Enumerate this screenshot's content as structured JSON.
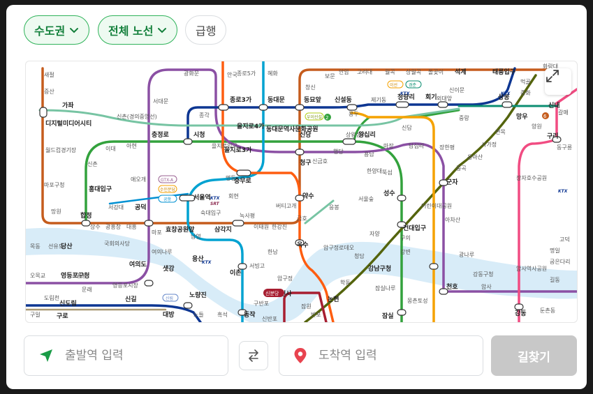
{
  "filters": {
    "region_label": "수도권",
    "lines_label": "전체 노선",
    "express_label": "급행"
  },
  "search": {
    "origin_placeholder": "출발역 입력",
    "destination_placeholder": "도착역 입력",
    "submit_label": "길찾기"
  },
  "colors": {
    "accent": "#2fb35a",
    "line1": "#0d3692",
    "line2": "#33a23d",
    "line3": "#fe5d10",
    "line4": "#00a2d1",
    "line5": "#8b50a4",
    "line6": "#c55c1d",
    "line7": "#54640d",
    "line8": "#f14c82",
    "line9": "#aa9872",
    "shinbundang": "#a71e31",
    "suinbundang": "#f5a200",
    "gyeongui": "#77c4a3",
    "river": "#d8ecf8"
  },
  "map": {
    "labels": [
      {
        "key": "s1",
        "text": "시청"
      },
      {
        "key": "s2",
        "text": "서울역"
      },
      {
        "key": "s3",
        "text": "종로3가"
      },
      {
        "key": "s4",
        "text": "동대문"
      },
      {
        "key": "s5",
        "text": "동묘앞"
      },
      {
        "key": "s6",
        "text": "신설동"
      },
      {
        "key": "s7",
        "text": "청량리"
      },
      {
        "key": "s8",
        "text": "회기"
      },
      {
        "key": "s9",
        "text": "상봉"
      },
      {
        "key": "s10",
        "text": "태릉입구"
      },
      {
        "key": "s11",
        "text": "신내"
      },
      {
        "key": "s12",
        "text": "구리"
      },
      {
        "key": "s13",
        "text": "왕십리"
      },
      {
        "key": "s14",
        "text": "신당"
      },
      {
        "key": "s15",
        "text": "동대문역사문화공원"
      },
      {
        "key": "s16",
        "text": "을지로3가"
      },
      {
        "key": "s17",
        "text": "을지로4가"
      },
      {
        "key": "s18",
        "text": "충무로"
      },
      {
        "key": "s19",
        "text": "약수"
      },
      {
        "key": "s20",
        "text": "청구"
      },
      {
        "key": "s21",
        "text": "충정로"
      },
      {
        "key": "s22",
        "text": "공덕"
      },
      {
        "key": "s23",
        "text": "합정"
      },
      {
        "key": "s24",
        "text": "홍대입구"
      },
      {
        "key": "s25",
        "text": "디지털미디어시티"
      },
      {
        "key": "s26",
        "text": "가좌"
      },
      {
        "key": "s27",
        "text": "삼각지"
      },
      {
        "key": "s28",
        "text": "효창공원앞"
      },
      {
        "key": "s29",
        "text": "용산"
      },
      {
        "key": "s30",
        "text": "이촌"
      },
      {
        "key": "s31",
        "text": "옥수"
      },
      {
        "key": "s32",
        "text": "성수"
      },
      {
        "key": "s33",
        "text": "건대입구"
      },
      {
        "key": "s34",
        "text": "군자"
      },
      {
        "key": "s35",
        "text": "천호"
      },
      {
        "key": "s36",
        "text": "강동"
      },
      {
        "key": "s37",
        "text": "잠실"
      },
      {
        "key": "s38",
        "text": "강남구청"
      },
      {
        "key": "s39",
        "text": "신사"
      },
      {
        "key": "s40",
        "text": "노량진"
      },
      {
        "key": "s41",
        "text": "여의도"
      },
      {
        "key": "s42",
        "text": "영등포구청"
      },
      {
        "key": "s43",
        "text": "당산"
      },
      {
        "key": "s44",
        "text": "신도림"
      },
      {
        "key": "s45",
        "text": "구로"
      },
      {
        "key": "s46",
        "text": "대방"
      },
      {
        "key": "s47",
        "text": "샛강"
      },
      {
        "key": "s48",
        "text": "신길"
      },
      {
        "key": "s49",
        "text": "동작"
      },
      {
        "key": "s50",
        "text": "논현"
      },
      {
        "key": "s51",
        "text": "석계"
      },
      {
        "key": "s52",
        "text": "망우"
      },
      {
        "key": "s53",
        "text": "종로5가"
      },
      {
        "key": "s54",
        "text": "혜화"
      },
      {
        "key": "s55",
        "text": "안국"
      },
      {
        "key": "s56",
        "text": "경복궁"
      },
      {
        "key": "s57",
        "text": "광화문"
      },
      {
        "key": "s58",
        "text": "서대문"
      },
      {
        "key": "s59",
        "text": "아현"
      },
      {
        "key": "s60",
        "text": "이대"
      },
      {
        "key": "s61",
        "text": "신촌"
      },
      {
        "key": "s62",
        "text": "마포구청"
      },
      {
        "key": "s63",
        "text": "망원"
      },
      {
        "key": "s64",
        "text": "상수"
      },
      {
        "key": "s65",
        "text": "광흥창"
      },
      {
        "key": "s66",
        "text": "대흥"
      },
      {
        "key": "s67",
        "text": "마포"
      },
      {
        "key": "s68",
        "text": "애오개"
      },
      {
        "key": "s69",
        "text": "서강대"
      },
      {
        "key": "s70",
        "text": "숙대입구"
      },
      {
        "key": "s71",
        "text": "남영"
      },
      {
        "key": "s72",
        "text": "녹사평"
      },
      {
        "key": "s73",
        "text": "이태원"
      },
      {
        "key": "s74",
        "text": "한강진"
      },
      {
        "key": "s75",
        "text": "버티고개"
      },
      {
        "key": "s76",
        "text": "금호"
      },
      {
        "key": "s77",
        "text": "응봉"
      },
      {
        "key": "s78",
        "text": "서빙고"
      },
      {
        "key": "s79",
        "text": "한남"
      },
      {
        "key": "s80",
        "text": "압구정"
      },
      {
        "key": "s81",
        "text": "신금호"
      },
      {
        "key": "s82",
        "text": "행당"
      },
      {
        "key": "s83",
        "text": "마장"
      },
      {
        "key": "s84",
        "text": "답십리"
      },
      {
        "key": "s85",
        "text": "장한평"
      },
      {
        "key": "s86",
        "text": "용답"
      },
      {
        "key": "s87",
        "text": "신답"
      },
      {
        "key": "s88",
        "text": "한양대"
      },
      {
        "key": "s89",
        "text": "뚝섬"
      },
      {
        "key": "s90",
        "text": "서울숲"
      },
      {
        "key": "s91",
        "text": "압구정로데오"
      },
      {
        "key": "s92",
        "text": "구의"
      },
      {
        "key": "s93",
        "text": "강변"
      },
      {
        "key": "s94",
        "text": "아차산"
      },
      {
        "key": "s95",
        "text": "광나루"
      },
      {
        "key": "s96",
        "text": "어린이대공원"
      },
      {
        "key": "s97",
        "text": "중곡"
      },
      {
        "key": "s98",
        "text": "용마산"
      },
      {
        "key": "s99",
        "text": "사가정"
      },
      {
        "key": "s100",
        "text": "면목"
      },
      {
        "key": "s101",
        "text": "중랑"
      },
      {
        "key": "s102",
        "text": "외대앞"
      },
      {
        "key": "s103",
        "text": "신이문"
      },
      {
        "key": "s104",
        "text": "고려대"
      },
      {
        "key": "s105",
        "text": "월곡"
      },
      {
        "key": "s106",
        "text": "상월곡"
      },
      {
        "key": "s107",
        "text": "돌곶이"
      },
      {
        "key": "s108",
        "text": "먹골"
      },
      {
        "key": "s109",
        "text": "중화"
      },
      {
        "key": "s110",
        "text": "화랑대"
      },
      {
        "key": "s111",
        "text": "양원"
      },
      {
        "key": "s112",
        "text": "갈매"
      },
      {
        "key": "s113",
        "text": "동구릉"
      },
      {
        "key": "s114",
        "text": "장자호수공원"
      },
      {
        "key": "s115",
        "text": "암사역사공원"
      },
      {
        "key": "s116",
        "text": "암사"
      },
      {
        "key": "s117",
        "text": "굽은다리"
      },
      {
        "key": "s118",
        "text": "명일"
      },
      {
        "key": "s119",
        "text": "고덕"
      },
      {
        "key": "s120",
        "text": "길동"
      },
      {
        "key": "s121",
        "text": "둔촌동"
      },
      {
        "key": "s122",
        "text": "강동구청"
      },
      {
        "key": "s123",
        "text": "몽촌토성"
      },
      {
        "key": "s124",
        "text": "잠실나루"
      },
      {
        "key": "s125",
        "text": "자양"
      },
      {
        "key": "s126",
        "text": "청담"
      },
      {
        "key": "s127",
        "text": "학동"
      },
      {
        "key": "s128",
        "text": "구반포"
      },
      {
        "key": "s129",
        "text": "신반포"
      },
      {
        "key": "s130",
        "text": "반포"
      },
      {
        "key": "s131",
        "text": "잠원"
      },
      {
        "key": "s132",
        "text": "흑석"
      },
      {
        "key": "s133",
        "text": "노들"
      },
      {
        "key": "s134",
        "text": "영등포시장"
      },
      {
        "key": "s135",
        "text": "양평"
      },
      {
        "key": "s136",
        "text": "문래"
      },
      {
        "key": "s137",
        "text": "도림천"
      },
      {
        "key": "s138",
        "text": "구일"
      },
      {
        "key": "s139",
        "text": "오목교"
      },
      {
        "key": "s140",
        "text": "목동"
      },
      {
        "key": "s141",
        "text": "선유도"
      },
      {
        "key": "s142",
        "text": "국회의사당"
      },
      {
        "key": "s143",
        "text": "여의나루"
      },
      {
        "key": "s144",
        "text": "월드컵경기장"
      },
      {
        "key": "s145",
        "text": "마포구청"
      },
      {
        "key": "s146",
        "text": "새절"
      },
      {
        "key": "s147",
        "text": "증산"
      },
      {
        "key": "s148",
        "text": "신촌(경의중앙선)"
      },
      {
        "key": "s149",
        "text": "서울역"
      },
      {
        "key": "s150",
        "text": "회현"
      },
      {
        "key": "s151",
        "text": "명동"
      },
      {
        "key": "s152",
        "text": "을지로입구"
      },
      {
        "key": "s153",
        "text": "종각"
      },
      {
        "key": "s154",
        "text": "제기동"
      },
      {
        "key": "s155",
        "text": "용두"
      },
      {
        "key": "s156",
        "text": "신답"
      },
      {
        "key": "s157",
        "text": "상왕십리"
      },
      {
        "key": "s158",
        "text": "동묘앞"
      },
      {
        "key": "s159",
        "text": "창신"
      },
      {
        "key": "s160",
        "text": "보문"
      },
      {
        "key": "s161",
        "text": "안암"
      },
      {
        "key": "s162",
        "text": "고려대"
      },
      {
        "key": "s163",
        "text": "신설동"
      }
    ],
    "badges": {
      "gtx": "GTX-A",
      "airport": "공항",
      "shinbundang": "신분당",
      "suinbundang": "수인분당",
      "gyeongchun": "경춘",
      "isl": "이선",
      "ktx": "KTX",
      "srt": "SRT",
      "sillim": "신림",
      "six": "6",
      "two": "2",
      "uisinseol": "우이신설"
    }
  }
}
